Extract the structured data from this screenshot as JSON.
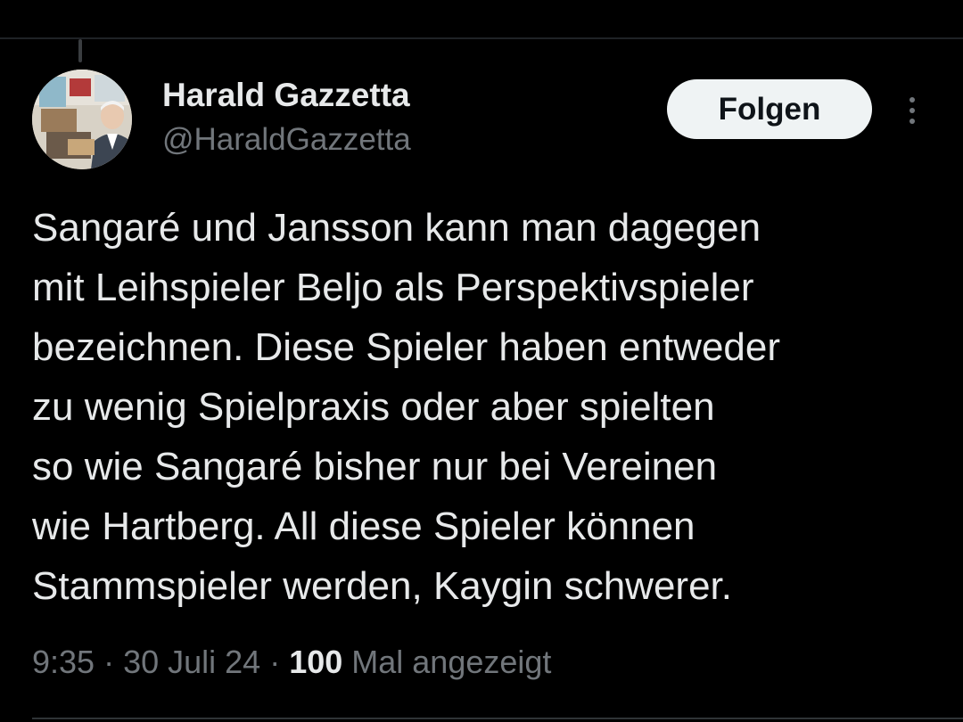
{
  "author": {
    "display_name": "Harald Gazzetta",
    "handle": "@HaraldGazzetta"
  },
  "actions": {
    "follow_label": "Folgen",
    "more_icon": "more-vertical-icon"
  },
  "tweet": {
    "lines": [
      "Sangaré und Jansson kann man dagegen",
      "mit Leihspieler Beljo als Perspektivspieler",
      "bezeichnen. Diese Spieler haben entweder",
      "zu wenig Spielpraxis oder aber spielten",
      "so wie Sangaré bisher nur bei Vereinen",
      "wie Hartberg. All diese Spieler können",
      "Stammspieler werden, Kaygin schwerer."
    ]
  },
  "meta": {
    "time": "9:35",
    "separator": " · ",
    "date": "30 Juli 24",
    "views_count": "100",
    "views_label": " Mal angezeigt"
  },
  "colors": {
    "background": "#000000",
    "primary_text": "#e7e9ea",
    "secondary_text": "#71767b",
    "button_bg": "#eff3f4",
    "button_text": "#0f1419"
  }
}
